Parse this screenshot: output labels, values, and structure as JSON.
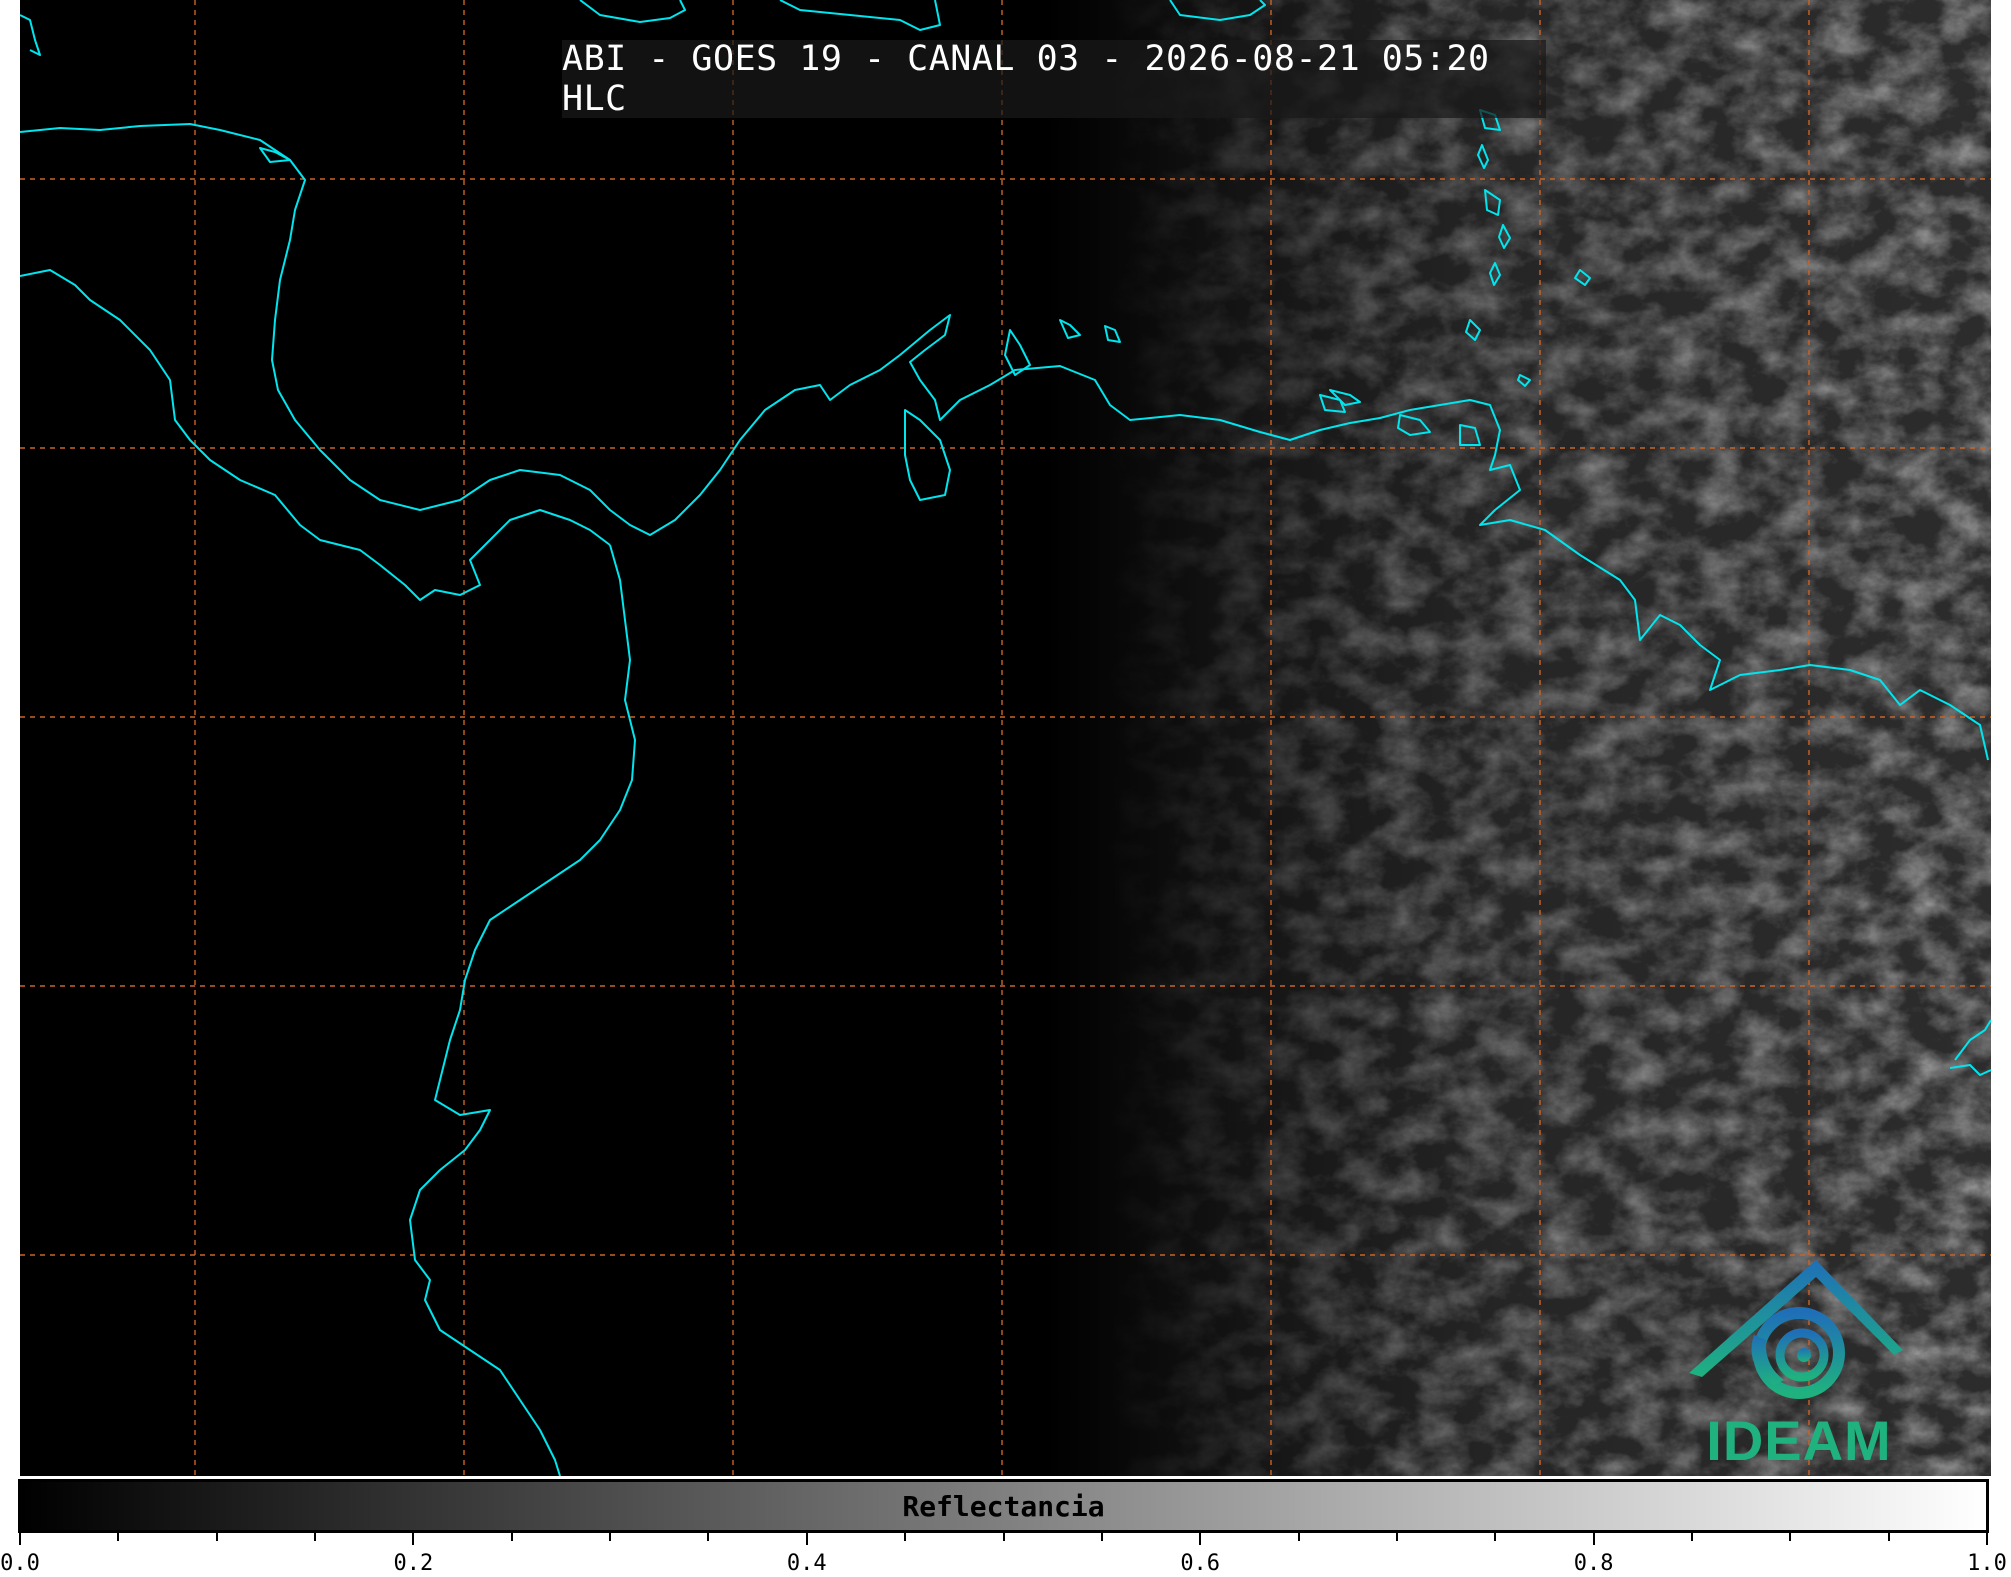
{
  "title": "ABI - GOES 19 - CANAL 03 - 2026-08-21 05:20 HLC",
  "logo_text": "IDEAM",
  "colorbar": {
    "label": "Reflectancia",
    "min": 0.0,
    "max": 1.0,
    "major_ticks": [
      "0.0",
      "0.2",
      "0.4",
      "0.6",
      "0.8",
      "1.0"
    ],
    "minor_step": 0.05
  },
  "colors": {
    "coastline": "#00e5ee",
    "gridline": "#c8642a",
    "logo_blue": "#1f78b4",
    "logo_green": "#1fb27f"
  }
}
